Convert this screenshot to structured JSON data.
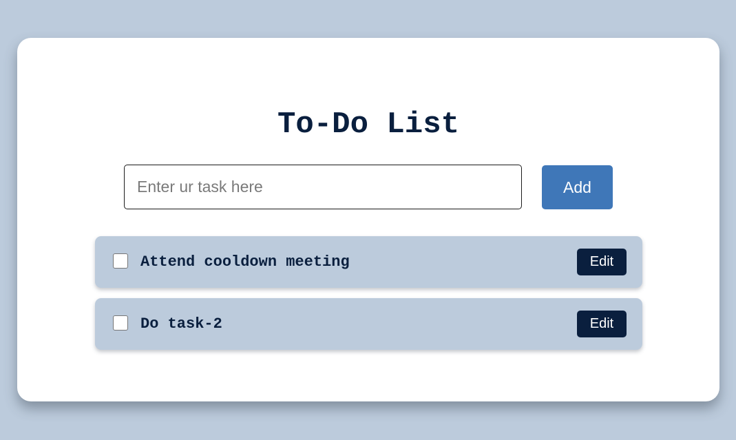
{
  "app": {
    "title": "To-Do List"
  },
  "input": {
    "placeholder": "Enter ur task here",
    "value": ""
  },
  "add_button": {
    "label": "Add"
  },
  "tasks": [
    {
      "text": "Attend cooldown meeting",
      "done": false,
      "edit_label": "Edit"
    },
    {
      "text": "Do task-2",
      "done": false,
      "edit_label": "Edit"
    }
  ],
  "colors": {
    "page_background": "#bccbdc",
    "card_background": "#ffffff",
    "accent": "#3f77b8",
    "dark_navy": "#0a1f3e",
    "task_background": "#bccbdc"
  }
}
